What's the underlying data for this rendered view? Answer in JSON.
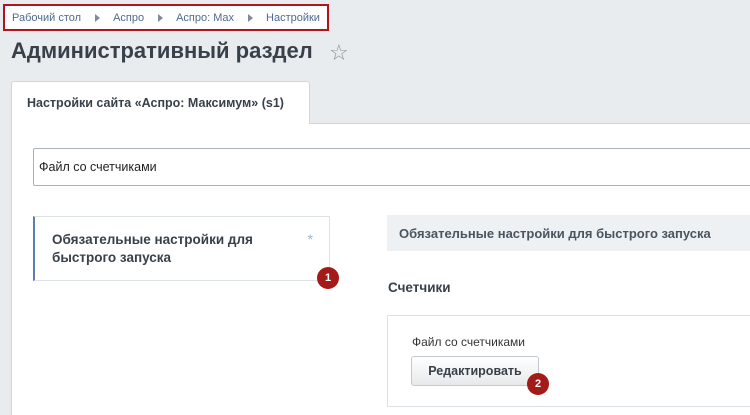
{
  "breadcrumb": [
    "Рабочий стол",
    "Аспро",
    "Аспро: Max",
    "Настройки"
  ],
  "page": {
    "title": "Административный раздел"
  },
  "tab": {
    "label": "Настройки сайта «Аспро: Максимум» (s1)"
  },
  "search": {
    "value": "Файл со счетчиками"
  },
  "sidebar": {
    "item_label": "Обязательные настройки для быстрого запуска"
  },
  "section": {
    "header": "Обязательные настройки для быстрого запуска",
    "group_title": "Счетчики",
    "field_label": "Файл со счетчиками",
    "edit_button": "Редактировать"
  },
  "annotations": {
    "badge_1": "1",
    "badge_2": "2"
  },
  "colors": {
    "accent_red": "#a31b18",
    "link_blue": "#4d6b8f"
  },
  "icons": [
    "star-icon",
    "asterisk-icon",
    "chevron-right-icon"
  ]
}
